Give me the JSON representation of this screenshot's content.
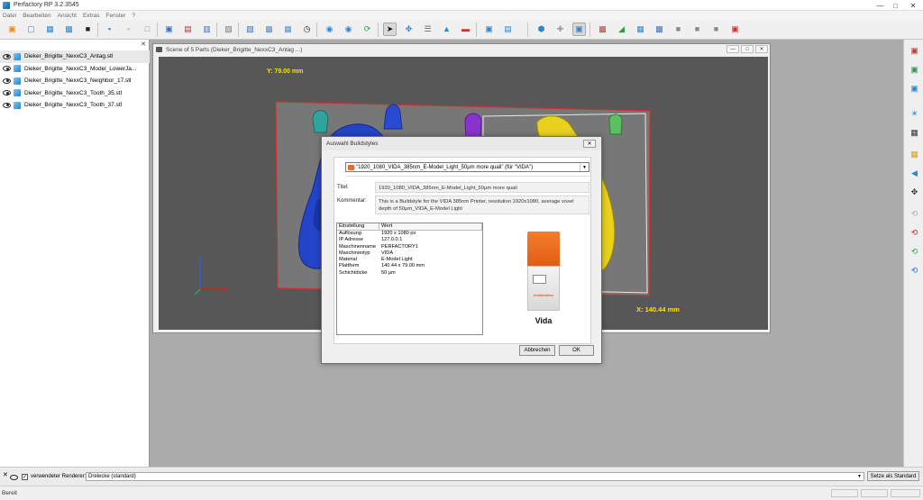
{
  "window": {
    "title": "Perfactory RP 3.2.3545"
  },
  "menu": [
    "Datei",
    "Bearbeiten",
    "Ansicht",
    "Extras",
    "Fenster",
    "?"
  ],
  "files": [
    "Dieker_Brigitte_NexxC3_Antag.stl",
    "Dieker_Brigitte_NexxC3_Model_LowerJa...",
    "Dieker_Brigitte_NexxC3_Neighbor_17.stl",
    "Dieker_Brigitte_NexxC3_Tooth_35.stl",
    "Dieker_Brigitte_NexxC3_Tooth_37.stl"
  ],
  "scene": {
    "title": "Scene of 5 Parts (Dieker_Brigitte_NexxC3_Antag ...)",
    "y_dim": "Y: 79.00 mm",
    "x_dim": "X: 140.44 mm"
  },
  "dialog": {
    "title": "Auswahl Buildstyles",
    "selected": "\"1920_1080_VIDA_385nm_E-Model_Light_50µm more quali\" (für \"VIDA\")",
    "titel_label": "Titel:",
    "titel_value": "1920_1080_VIDA_385nm_E-Model_Light_50µm more quali",
    "kommentar_label": "Kommentar:",
    "kommentar_value": "This is a Buildstyle for the VIDA 385nm Printer, resolution 1920x1080, average voxel depth of 50µm_VIDA_E-Model Light",
    "table": {
      "headers": [
        "Einstellung",
        "Wert"
      ],
      "rows": [
        [
          "Auflösung",
          "1920 x 1080 px"
        ],
        [
          "IP Adresse",
          "127.0.0.1"
        ],
        [
          "Maschinenname",
          "PERFACTORY1"
        ],
        [
          "Maschinentyp",
          "VIDA"
        ],
        [
          "Material",
          "E-Model Light"
        ],
        [
          "Plattform",
          "140.44 x 79.00 mm"
        ],
        [
          "Schichtdicke",
          "50 µm"
        ]
      ]
    },
    "printer_brand": "envisiontec",
    "printer_name": "Vida",
    "cancel_label": "Abbrechen",
    "ok_label": "OK"
  },
  "renderer": {
    "label": "verwendeter Renderer:",
    "value": "Dreiecke (standard)",
    "button": "Setze als Standard"
  },
  "status": {
    "text": "Bereit"
  },
  "colors": {
    "dim_text": "#ffe100",
    "viewport_bg": "#575757",
    "platform_border": "#d03030",
    "accent_orange": "#e35c14"
  }
}
